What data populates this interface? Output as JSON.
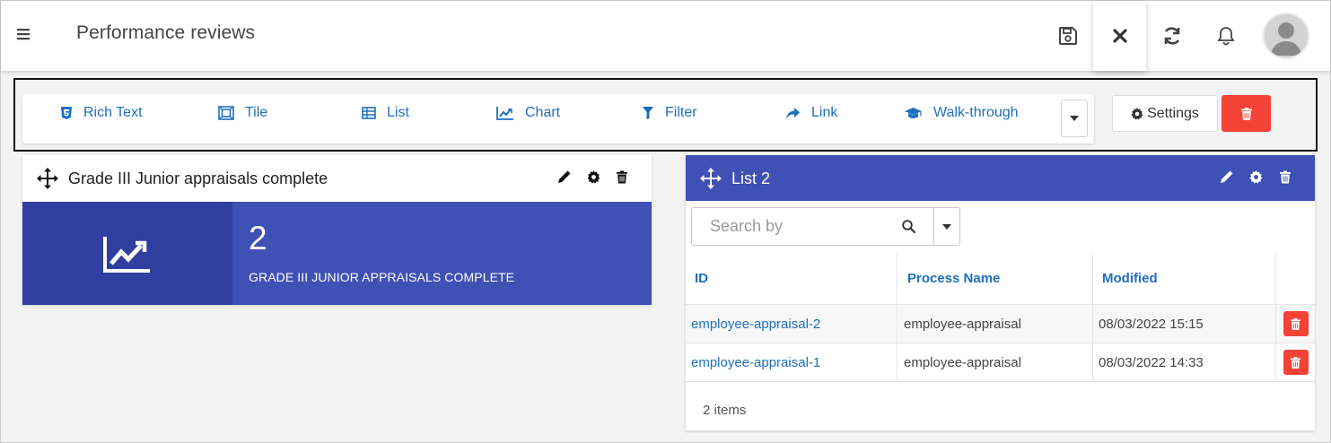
{
  "header": {
    "title": "Performance reviews",
    "icons": [
      "menu-icon",
      "save-icon",
      "close-icon",
      "refresh-icon",
      "bell-icon",
      "avatar"
    ]
  },
  "toolbar": {
    "items": [
      {
        "label": "Rich Text",
        "icon": "html5-icon"
      },
      {
        "label": "Tile",
        "icon": "tile-icon"
      },
      {
        "label": "List",
        "icon": "table-icon"
      },
      {
        "label": "Chart",
        "icon": "line-chart-icon"
      },
      {
        "label": "Filter",
        "icon": "filter-icon"
      },
      {
        "label": "Link",
        "icon": "share-arrow-icon"
      },
      {
        "label": "Walk-through",
        "icon": "graduation-cap-icon"
      }
    ],
    "settings_label": "Settings"
  },
  "tile_widget": {
    "title": "Grade III Junior appraisals complete",
    "value": "2",
    "caption": "GRADE III JUNIOR APPRAISALS COMPLETE"
  },
  "list_widget": {
    "title": "List 2",
    "search_placeholder": "Search by",
    "columns": [
      "ID",
      "Process Name",
      "Modified"
    ],
    "rows": [
      {
        "id": "employee-appraisal-2",
        "process": "employee-appraisal",
        "modified": "08/03/2022 15:15"
      },
      {
        "id": "employee-appraisal-1",
        "process": "employee-appraisal",
        "modified": "08/03/2022 14:33"
      }
    ],
    "footer": "2 items"
  },
  "colors": {
    "primary": "#3f51b5",
    "primary_dark": "#303f9f",
    "link": "#1f6fbf",
    "danger": "#f44336"
  }
}
